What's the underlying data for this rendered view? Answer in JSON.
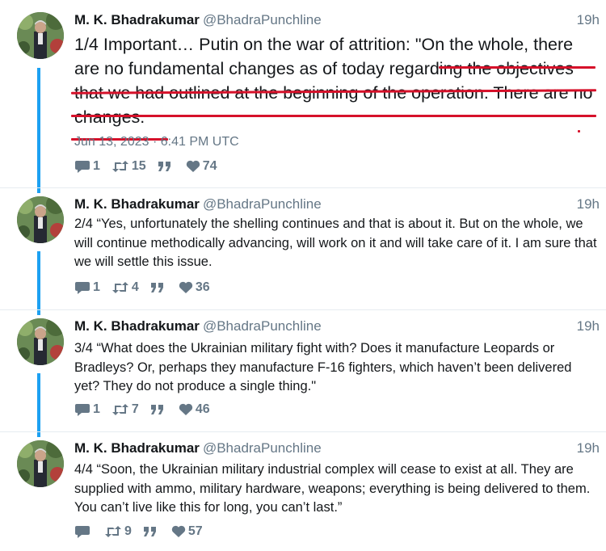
{
  "tweets": [
    {
      "author": "M. K. Bhadrakumar",
      "handle": "@BhadraPunchline",
      "time": "19h",
      "text": "1/4 Important… Putin on the war of attrition: \"On the whole, there are no fundamental changes as of today regarding the objectives that we had outlined at the beginning of the operation. There are no changes.",
      "date": "Jun 13, 2023 · 6:41 PM UTC",
      "replies": "1",
      "retweets": "15",
      "quotes": "",
      "likes": "74"
    },
    {
      "author": "M. K. Bhadrakumar",
      "handle": "@BhadraPunchline",
      "time": "19h",
      "text": "2/4 “Yes, unfortunately the shelling continues and that is about it. But on the whole, we will continue methodically advancing, will work on it and will take care of it. I am sure that we will settle this issue.",
      "replies": "1",
      "retweets": "4",
      "quotes": "",
      "likes": "36"
    },
    {
      "author": "M. K. Bhadrakumar",
      "handle": "@BhadraPunchline",
      "time": "19h",
      "text": "3/4 “What does the Ukrainian military fight with? Does it manufacture Leopards or Bradleys? Or, perhaps they manufacture F-16 fighters, which haven’t been delivered yet? They do not produce a single thing.\"",
      "replies": "1",
      "retweets": "7",
      "quotes": "",
      "likes": "46"
    },
    {
      "author": "M. K. Bhadrakumar",
      "handle": "@BhadraPunchline",
      "time": "19h",
      "text": "4/4 “Soon, the Ukrainian military industrial complex will cease to exist at all. They are supplied with ammo, military hardware, weapons; everything is being delivered to them. You can’t live like this for long, you can’t last.”",
      "replies": "",
      "retweets": "9",
      "quotes": "",
      "likes": "57"
    }
  ],
  "icons": [
    "reply-icon",
    "retweet-icon",
    "quote-icon",
    "heart-icon"
  ],
  "colors": {
    "accent": "#1da1f2",
    "muted": "#657786",
    "annotation_red": "#d6112a"
  }
}
